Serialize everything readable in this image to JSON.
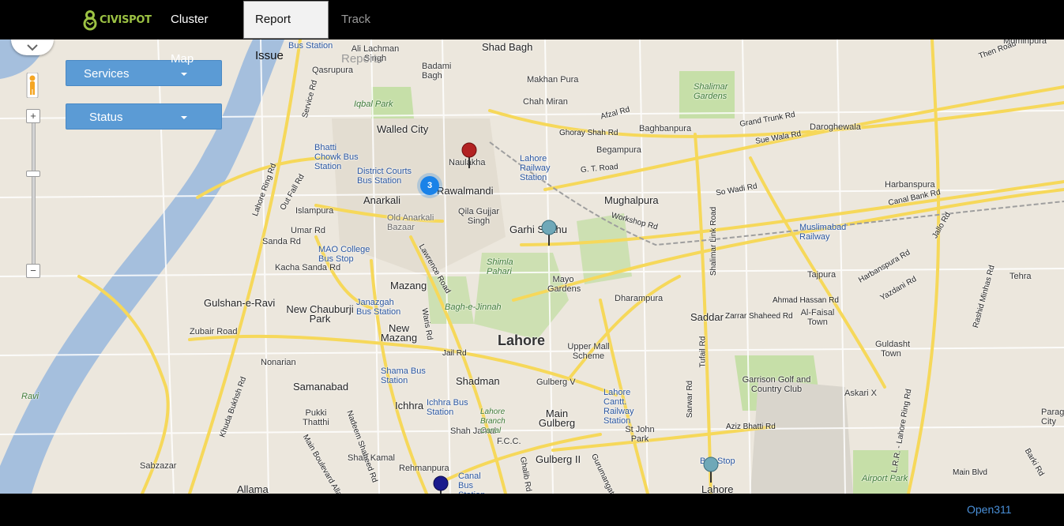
{
  "brand": {
    "name": "CIVISPOT",
    "color": "#9cc243"
  },
  "nav": {
    "cluster_map": "Cluster Map",
    "report_issue": "Report Issue",
    "track_reports": "Track Reports"
  },
  "filters": {
    "services": "Services",
    "status": "Status"
  },
  "map": {
    "zoom_in": "+",
    "zoom_out": "−",
    "cluster_count": "3",
    "city_label": "Lahore",
    "labels": [
      "Bus Station",
      "Qasrupura",
      "Ali Lachman Singh",
      "Badami Bagh",
      "Shad Bagh",
      "Iqbal Park",
      "Walled City",
      "Bhatti Chowk Bus Station",
      "District Courts Bus Station",
      "Naulakha",
      "Anarkali",
      "Old Anarkali Bazaar",
      "Islampura",
      "Umar Rd",
      "Sanda Rd",
      "MAO College Bus Stop",
      "Kacha Sanda Rd",
      "Gulshan-e-Ravi",
      "New Chauburji Park",
      "Janazgah Bus Station",
      "Mazang",
      "New Mazang",
      "Zubair Road",
      "Nonarian",
      "Samanabad",
      "Shama Bus Station",
      "Ichhra",
      "Ichhra Bus Station",
      "Shadman",
      "Shah Jamal",
      "Pukki Thatthi",
      "Shah Kamal",
      "Rehmanpura",
      "Canal Bus Station",
      "Sabzazar",
      "Allama",
      "Ravi",
      "Lahore Railway Station",
      "Qila Gujjar Singh",
      "Garhi Shahu",
      "Shimla Pahari",
      "Mayo Gardens",
      "Bagh-e-Jinnah",
      "Upper Mall Scheme",
      "Gulberg V",
      "Main Gulberg",
      "Gulberg II",
      "F.C.C.",
      "Lahore Cantt. Railway Station",
      "St John Park",
      "Mughalpura",
      "Workshop Rd",
      "Dharampura",
      "Saddar",
      "Zarrar Shaheed Rd",
      "Al-Faisal Town",
      "Ahmad Hassan Rd",
      "Garrison Golf and Country Club",
      "Askari X",
      "Aziz Bhatti Rd",
      "Bus Stop",
      "Lahore",
      "Begampura",
      "Baghbanpura",
      "Shalimar Gardens",
      "Chah Miran",
      "Makhan Pura",
      "Ghoray Shah Rd",
      "Afzal Rd",
      "Grand Trunk Rd",
      "Sue Wala Rd",
      "G. T. Road",
      "Daroghewala",
      "Harbanspura",
      "Canal Bank Rd",
      "Muslimabad Railway",
      "Tajpura",
      "Harbanspura Rd",
      "Yazdani Rd",
      "Tehra",
      "Guldasht Town",
      "Main Blvd",
      "Airport Park",
      "So Wadi Rd",
      "Jallo Rd",
      "Shalimar Link Road",
      "L.R.R. - Lahore Ring Rd",
      "Paragon City",
      "Barki Rd",
      "Rashid Minhas Rd",
      "Lawrence Road",
      "Jail Rd",
      "Waris Rd",
      "Main Boulevard Allama",
      "Nadeem Shaheed Rd",
      "Ghalib Rd",
      "Gurumangat",
      "Sarwar Rd",
      "Tufail Rd",
      "Out Fall Rd",
      "Lahore Ring Rd",
      "Khuda Bukhsh Rd",
      "Service Rd",
      "Lahore Branch Canal",
      "Rawalmandi",
      "Then Road",
      "Mominpura"
    ]
  },
  "footer": {
    "link": "Open311"
  }
}
